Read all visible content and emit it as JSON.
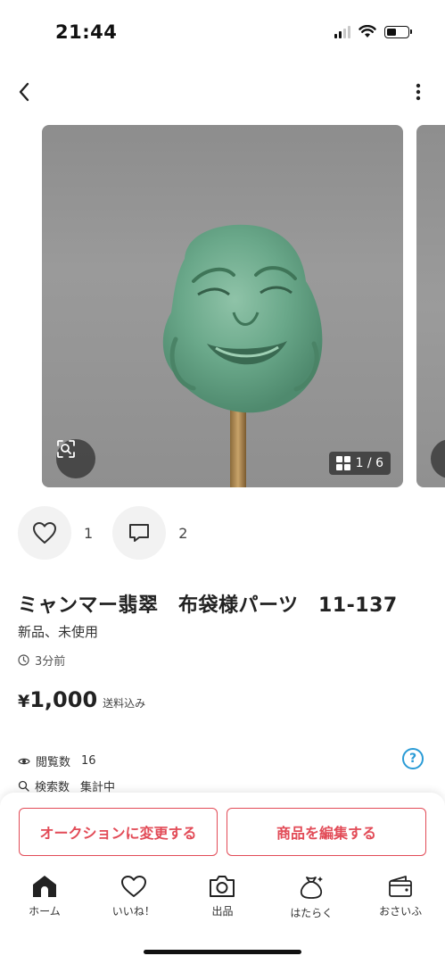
{
  "status_bar": {
    "time": "21:44"
  },
  "product": {
    "title": "ミャンマー翡翠　布袋様パーツ　11-137",
    "condition": "新品、未使用",
    "posted": "3分前",
    "price_symbol": "¥",
    "price": "1,000",
    "shipping": "送料込み",
    "image_counter": "1 / 6"
  },
  "reactions": {
    "likes": "1",
    "comments": "2"
  },
  "stats": {
    "views_label": "閲覧数",
    "views_value": "16",
    "search_label": "検索数",
    "search_value": "集計中"
  },
  "actions": {
    "auction_label": "オークションに変更する",
    "edit_label": "商品を編集する"
  },
  "tab_bar": {
    "items": [
      {
        "label": "ホーム",
        "icon": "home-icon"
      },
      {
        "label": "いいね！",
        "icon": "heart-icon"
      },
      {
        "label": "出品",
        "icon": "camera-icon"
      },
      {
        "label": "はたらく",
        "icon": "money-bag-icon"
      },
      {
        "label": "おさいふ",
        "icon": "wallet-icon"
      }
    ]
  },
  "colors": {
    "accent": "#e24b57",
    "help": "#2a9bd6",
    "jade": "#6aa88a"
  }
}
